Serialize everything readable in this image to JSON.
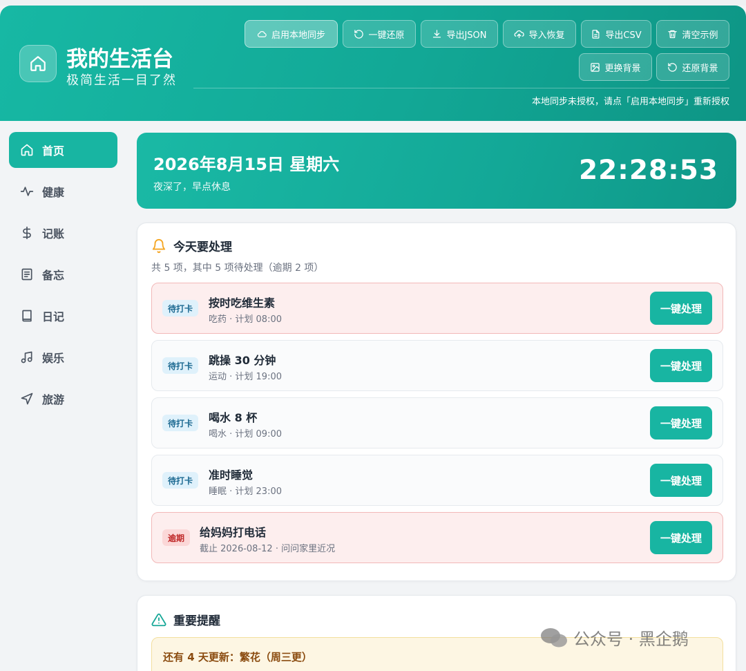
{
  "header": {
    "title": "我的生活台",
    "subtitle": "极简生活一目了然",
    "buttons": {
      "sync": "启用本地同步",
      "restore": "一键还原",
      "export_json": "导出JSON",
      "import": "导入恢复",
      "export_csv": "导出CSV",
      "clear": "清空示例",
      "change_bg": "更换背景",
      "restore_bg": "还原背景"
    },
    "notice": "本地同步未授权，请点「启用本地同步」重新授权"
  },
  "sidebar": {
    "items": [
      {
        "label": "首页",
        "icon": "home-icon"
      },
      {
        "label": "健康",
        "icon": "pulse-icon"
      },
      {
        "label": "记账",
        "icon": "dollar-icon"
      },
      {
        "label": "备忘",
        "icon": "note-icon"
      },
      {
        "label": "日记",
        "icon": "book-icon"
      },
      {
        "label": "娱乐",
        "icon": "music-icon"
      },
      {
        "label": "旅游",
        "icon": "navigation-icon"
      }
    ]
  },
  "date_card": {
    "date": "2026年8月15日 星期六",
    "greeting": "夜深了，早点休息",
    "time": "22:28:53"
  },
  "today": {
    "title": "今天要处理",
    "summary": "共 5 项，其中 5 项待处理（逾期 2 项）",
    "action_label": "一键处理",
    "tasks": [
      {
        "badge": "待打卡",
        "name": "按时吃维生素",
        "meta": "吃药 · 计划 08:00"
      },
      {
        "badge": "待打卡",
        "name": "跳操 30 分钟",
        "meta": "运动 · 计划 19:00"
      },
      {
        "badge": "待打卡",
        "name": "喝水 8 杯",
        "meta": "喝水 · 计划 09:00"
      },
      {
        "badge": "待打卡",
        "name": "准时睡觉",
        "meta": "睡眠 · 计划 23:00"
      },
      {
        "badge": "逾期",
        "name": "给妈妈打电话",
        "meta": "截止 2026-08-12 · 问问家里近况"
      }
    ]
  },
  "reminders": {
    "title": "重要提醒",
    "items": [
      {
        "text": "还有 4 天更新：繁花（周三更）"
      }
    ]
  },
  "watermark": "公众号 · 黑企鹅",
  "colors": {
    "accent": "#18b5a2",
    "danger_bg": "#fdeeee",
    "warning_bg": "#fdf6e3",
    "bell": "#f5a623"
  }
}
